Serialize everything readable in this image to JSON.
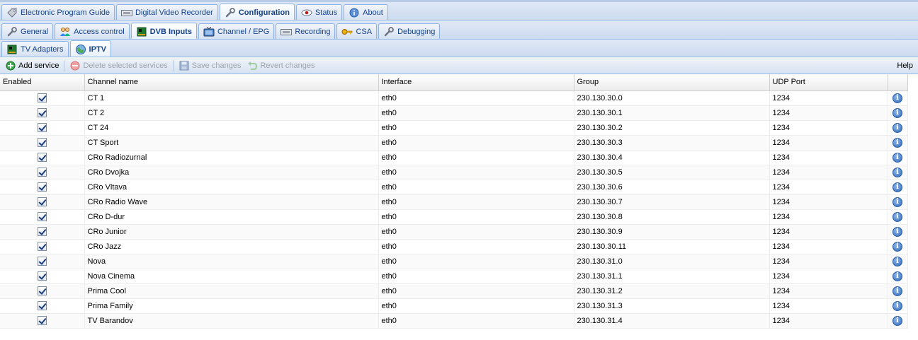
{
  "main_tabs": [
    {
      "label": "Electronic Program Guide",
      "icon": "tag-icon"
    },
    {
      "label": "Digital Video Recorder",
      "icon": "recorder-icon"
    },
    {
      "label": "Configuration",
      "icon": "wrench-icon",
      "active": true
    },
    {
      "label": "Status",
      "icon": "eye-icon"
    },
    {
      "label": "About",
      "icon": "info-icon"
    }
  ],
  "config_tabs": [
    {
      "label": "General",
      "icon": "wrench-icon"
    },
    {
      "label": "Access control",
      "icon": "users-icon"
    },
    {
      "label": "DVB Inputs",
      "icon": "card-icon",
      "active": true
    },
    {
      "label": "Channel / EPG",
      "icon": "tv-icon"
    },
    {
      "label": "Recording",
      "icon": "recorder-icon"
    },
    {
      "label": "CSA",
      "icon": "key-icon"
    },
    {
      "label": "Debugging",
      "icon": "wrench-icon"
    }
  ],
  "dvb_tabs": [
    {
      "label": "TV Adapters",
      "icon": "card-icon"
    },
    {
      "label": "IPTV",
      "icon": "globe-icon",
      "active": true
    }
  ],
  "toolbar": {
    "add_label": "Add service",
    "delete_label": "Delete selected services",
    "save_label": "Save changes",
    "revert_label": "Revert changes",
    "help_label": "Help"
  },
  "grid": {
    "headers": {
      "enabled": "Enabled",
      "channel": "Channel name",
      "interface": "Interface",
      "group": "Group",
      "port": "UDP Port"
    },
    "rows": [
      {
        "enabled": true,
        "channel": "CT 1",
        "interface": "eth0",
        "group": "230.130.30.0",
        "port": "1234"
      },
      {
        "enabled": true,
        "channel": "CT 2",
        "interface": "eth0",
        "group": "230.130.30.1",
        "port": "1234"
      },
      {
        "enabled": true,
        "channel": "CT 24",
        "interface": "eth0",
        "group": "230.130.30.2",
        "port": "1234"
      },
      {
        "enabled": true,
        "channel": "CT Sport",
        "interface": "eth0",
        "group": "230.130.30.3",
        "port": "1234"
      },
      {
        "enabled": true,
        "channel": "CRo Radiozurnal",
        "interface": "eth0",
        "group": "230.130.30.4",
        "port": "1234"
      },
      {
        "enabled": true,
        "channel": "CRo Dvojka",
        "interface": "eth0",
        "group": "230.130.30.5",
        "port": "1234"
      },
      {
        "enabled": true,
        "channel": "CRo Vltava",
        "interface": "eth0",
        "group": "230.130.30.6",
        "port": "1234"
      },
      {
        "enabled": true,
        "channel": "CRo Radio Wave",
        "interface": "eth0",
        "group": "230.130.30.7",
        "port": "1234"
      },
      {
        "enabled": true,
        "channel": "CRo D-dur",
        "interface": "eth0",
        "group": "230.130.30.8",
        "port": "1234"
      },
      {
        "enabled": true,
        "channel": "CRo Junior",
        "interface": "eth0",
        "group": "230.130.30.9",
        "port": "1234"
      },
      {
        "enabled": true,
        "channel": "CRo Jazz",
        "interface": "eth0",
        "group": "230.130.30.11",
        "port": "1234"
      },
      {
        "enabled": true,
        "channel": "Nova",
        "interface": "eth0",
        "group": "230.130.31.0",
        "port": "1234"
      },
      {
        "enabled": true,
        "channel": "Nova Cinema",
        "interface": "eth0",
        "group": "230.130.31.1",
        "port": "1234"
      },
      {
        "enabled": true,
        "channel": "Prima Cool",
        "interface": "eth0",
        "group": "230.130.31.2",
        "port": "1234"
      },
      {
        "enabled": true,
        "channel": "Prima Family",
        "interface": "eth0",
        "group": "230.130.31.3",
        "port": "1234"
      },
      {
        "enabled": true,
        "channel": "TV Barandov",
        "interface": "eth0",
        "group": "230.130.31.4",
        "port": "1234"
      }
    ]
  }
}
